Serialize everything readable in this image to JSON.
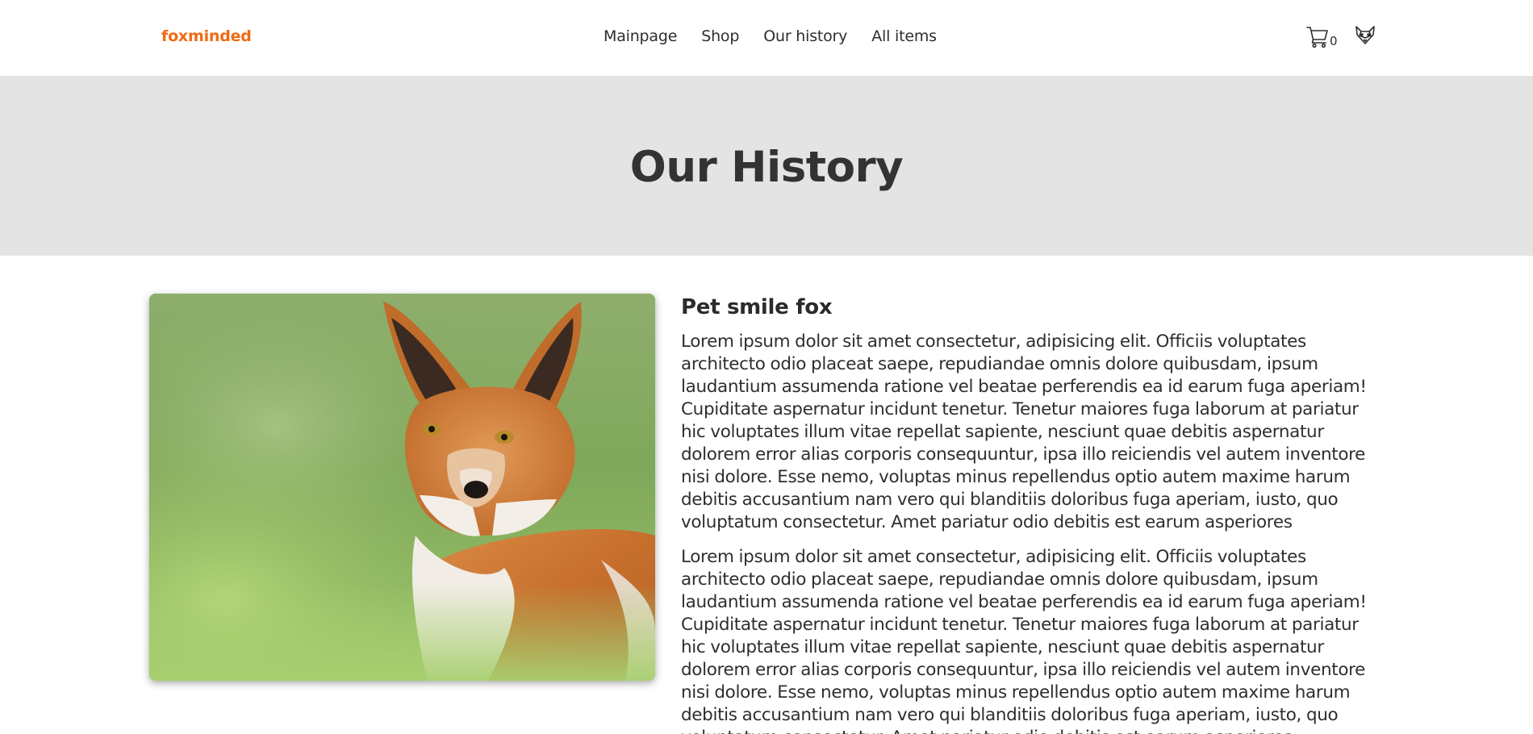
{
  "header": {
    "logo": "foxminded",
    "nav": [
      {
        "label": "Mainpage"
      },
      {
        "label": "Shop"
      },
      {
        "label": "Our history"
      },
      {
        "label": "All items"
      }
    ],
    "cart_count": "0",
    "icons": {
      "cart": "cart-icon",
      "profile": "fox-profile-icon"
    }
  },
  "hero": {
    "title": "Our History"
  },
  "article": {
    "image_subject": "red fox portrait on green grass",
    "heading": "Pet smile fox",
    "paragraphs": [
      "Lorem ipsum dolor sit amet consectetur, adipisicing elit. Officiis voluptates architecto odio placeat saepe, repudiandae omnis dolore quibusdam, ipsum laudantium assumenda ratione vel beatae perferendis ea id earum fuga aperiam! Cupiditate aspernatur incidunt tenetur. Tenetur maiores fuga laborum at pariatur hic voluptates illum vitae repellat sapiente, nesciunt quae debitis aspernatur dolorem error alias corporis consequuntur, ipsa illo reiciendis vel autem inventore nisi dolore. Esse nemo, voluptas minus repellendus optio autem maxime harum debitis accusantium nam vero qui blanditiis doloribus fuga aperiam, iusto, quo voluptatum consectetur. Amet pariatur odio debitis est earum asperiores",
      "Lorem ipsum dolor sit amet consectetur, adipisicing elit. Officiis voluptates architecto odio placeat saepe, repudiandae omnis dolore quibusdam, ipsum laudantium assumenda ratione vel beatae perferendis ea id earum fuga aperiam! Cupiditate aspernatur incidunt tenetur. Tenetur maiores fuga laborum at pariatur hic voluptates illum vitae repellat sapiente, nesciunt quae debitis aspernatur dolorem error alias corporis consequuntur, ipsa illo reiciendis vel autem inventore nisi dolore. Esse nemo, voluptas minus repellendus optio autem maxime harum debitis accusantium nam vero qui blanditiis doloribus fuga aperiam, iusto, quo voluptatum consectetur. Amet pariatur odio debitis est earum asperiores"
    ]
  },
  "colors": {
    "brand": "#f06a12",
    "hero_bg": "#e4e4e4",
    "text": "#2e2e2e"
  }
}
